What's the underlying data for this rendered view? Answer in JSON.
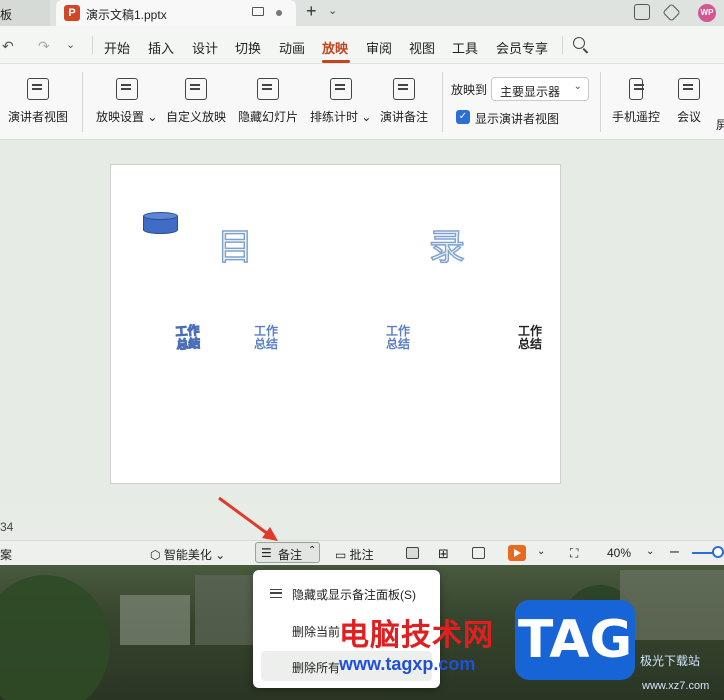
{
  "tabbar": {
    "prev_tab_label": "模板",
    "active_tab_title": "演示文稿1.pptx",
    "logo_letter": "P",
    "avatar_text": "WP"
  },
  "menubar": {
    "items": [
      "开始",
      "插入",
      "设计",
      "切换",
      "动画",
      "放映",
      "审阅",
      "视图",
      "工具",
      "会员专享"
    ],
    "active": "放映"
  },
  "ribbon": {
    "buttons": [
      "演讲者视图",
      "放映设置",
      "自定义放映",
      "隐藏幻灯片",
      "排练计时",
      "演讲备注",
      "手机遥控",
      "会议",
      "屏"
    ],
    "show_on_label": "放映到",
    "show_on_value": "主要显示器",
    "presenter_view_check": "显示演讲者视图"
  },
  "slide": {
    "title_left": "目",
    "title_right": "录",
    "items": [
      "工作总结",
      "工作总结",
      "工作总结",
      "工作总结"
    ]
  },
  "status": {
    "page_fragment": "34",
    "left_fragment": "案",
    "beautify": "智能美化",
    "notes": "备注",
    "comments": "批注",
    "zoom": "40%"
  },
  "notes_menu": {
    "items": [
      "隐藏或显示备注面板(S)",
      "删除当前页备注",
      "删除所有备注"
    ],
    "visible_texts": [
      "隐藏或显示备注面板(S)",
      "删除当前",
      "删除所有"
    ]
  },
  "watermark": {
    "title": "电脑技术网",
    "url": "www.tagxp.com",
    "tag": "TAG",
    "site": "极光下载站",
    "site_url": "www.xz7.com"
  },
  "colors": {
    "accent": "#c4421e",
    "checkbox": "#2b6fd6",
    "watermark_red": "#e02020",
    "watermark_blue": "#2050d8",
    "tag_bg": "#1764d6"
  }
}
